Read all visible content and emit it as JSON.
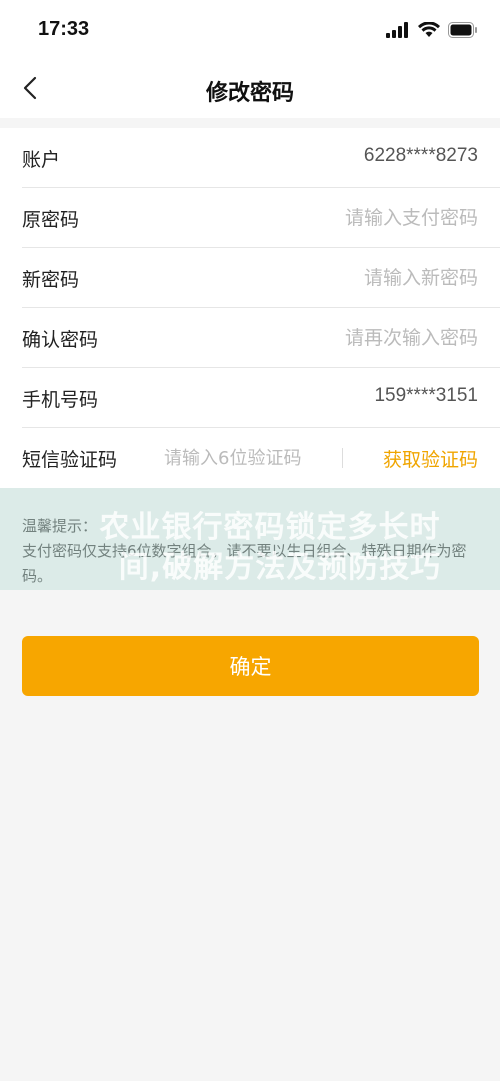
{
  "status_bar": {
    "time": "17:33",
    "icons": [
      "signal-icon",
      "wifi-icon",
      "battery-icon"
    ]
  },
  "nav": {
    "title": "修改密码",
    "back_icon": "chevron-left-icon"
  },
  "form": {
    "account": {
      "label": "账户",
      "value": "6228****8273"
    },
    "old_password": {
      "label": "原密码",
      "placeholder": "请输入支付密码"
    },
    "new_password": {
      "label": "新密码",
      "placeholder": "请输入新密码"
    },
    "confirm_password": {
      "label": "确认密码",
      "placeholder": "请再次输入密码"
    },
    "phone": {
      "label": "手机号码",
      "value": "159****3151"
    },
    "sms_code": {
      "label": "短信验证码",
      "placeholder": "请输入6位验证码",
      "button_label": "获取验证码"
    }
  },
  "tips": {
    "title": "温馨提示：",
    "text": "支付密码仅支持6位数字组合，请不要以生日组合、特殊日期作为密码。"
  },
  "watermark": {
    "line1": "农业银行密码锁定多长时",
    "line2": "间,破解方法及预防技巧"
  },
  "confirm_button": {
    "label": "确定"
  },
  "colors": {
    "accent": "#f7a600",
    "sms_link": "#f0a500",
    "background": "#f5f5f5"
  }
}
